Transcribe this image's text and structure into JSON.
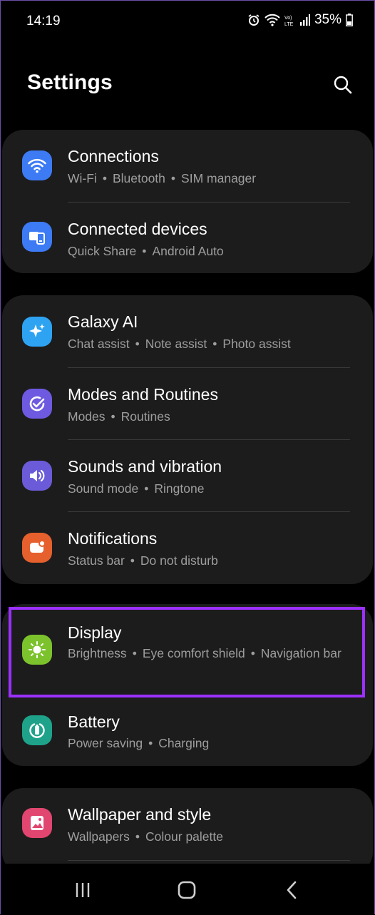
{
  "status": {
    "time": "14:19",
    "battery": "35%",
    "icons": [
      "alarm-icon",
      "wifi-icon",
      "volte-icon",
      "signal-icon",
      "battery-icon"
    ]
  },
  "header": {
    "title": "Settings",
    "search_icon": "search-icon"
  },
  "groups": [
    {
      "items": [
        {
          "label": "Connections",
          "subs": [
            "Wi-Fi",
            "Bluetooth",
            "SIM manager"
          ],
          "icon": "wifi-icon",
          "color": "#3d7bf5"
        },
        {
          "label": "Connected devices",
          "subs": [
            "Quick Share",
            "Android Auto"
          ],
          "icon": "devices-icon",
          "color": "#3d7bf5"
        }
      ]
    },
    {
      "items": [
        {
          "label": "Galaxy AI",
          "subs": [
            "Chat assist",
            "Note assist",
            "Photo assist"
          ],
          "icon": "sparkle-icon",
          "color": "#2ea3f2"
        },
        {
          "label": "Modes and Routines",
          "subs": [
            "Modes",
            "Routines"
          ],
          "icon": "check-circle-icon",
          "color": "#6d5ae0"
        },
        {
          "label": "Sounds and vibration",
          "subs": [
            "Sound mode",
            "Ringtone"
          ],
          "icon": "speaker-icon",
          "color": "#6b5bd9"
        },
        {
          "label": "Notifications",
          "subs": [
            "Status bar",
            "Do not disturb"
          ],
          "icon": "notification-icon",
          "color": "#e5602d"
        }
      ]
    },
    {
      "items": [
        {
          "label": "Display",
          "subs": [
            "Brightness",
            "Eye comfort shield",
            "Navigation bar"
          ],
          "icon": "sun-icon",
          "color": "#7cc22d"
        },
        {
          "label": "Battery",
          "subs": [
            "Power saving",
            "Charging"
          ],
          "icon": "battery-circle-icon",
          "color": "#1ea38a"
        }
      ]
    },
    {
      "items": [
        {
          "label": "Wallpaper and style",
          "subs": [
            "Wallpapers",
            "Colour palette"
          ],
          "icon": "wallpaper-icon",
          "color": "#e0466f"
        }
      ]
    }
  ],
  "nav": {
    "recents": "recents-icon",
    "home": "home-icon",
    "back": "back-icon"
  },
  "highlight_color": "#9b30ff"
}
